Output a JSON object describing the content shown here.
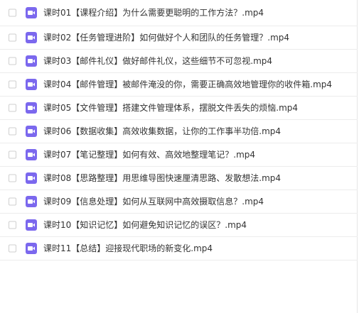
{
  "files": [
    {
      "name": "课时01【课程介绍】为什么需要更聪明的工作方法？.mp4",
      "icon": "video-file-icon"
    },
    {
      "name": "课时02【任务管理进阶】如何做好个人和团队的任务管理？.mp4",
      "icon": "video-file-icon"
    },
    {
      "name": "课时03【邮件礼仪】做好邮件礼仪，这些细节不可忽视.mp4",
      "icon": "video-file-icon"
    },
    {
      "name": "课时04【邮件管理】被邮件淹没的你，需要正确高效地管理你的收件箱.mp4",
      "icon": "video-file-icon"
    },
    {
      "name": "课时05【文件管理】搭建文件管理体系，摆脱文件丢失的烦恼.mp4",
      "icon": "video-file-icon"
    },
    {
      "name": "课时06【数据收集】高效收集数据，让你的工作事半功倍.mp4",
      "icon": "video-file-icon"
    },
    {
      "name": "课时07【笔记整理】如何有效、高效地整理笔记？.mp4",
      "icon": "video-file-icon"
    },
    {
      "name": "课时08【思路整理】用思维导图快速厘清思路、发散想法.mp4",
      "icon": "video-file-icon"
    },
    {
      "name": "课时09【信息处理】如何从互联网中高效摄取信息？.mp4",
      "icon": "video-file-icon"
    },
    {
      "name": "课时10【知识记忆】如何避免知识记忆的误区？.mp4",
      "icon": "video-file-icon"
    },
    {
      "name": "课时11【总结】迎接现代职场的新变化.mp4",
      "icon": "video-file-icon"
    }
  ],
  "colors": {
    "icon_bg": "#7b68ee",
    "checkbox_border": "#cfcfcf",
    "row_divider": "#ececec"
  }
}
